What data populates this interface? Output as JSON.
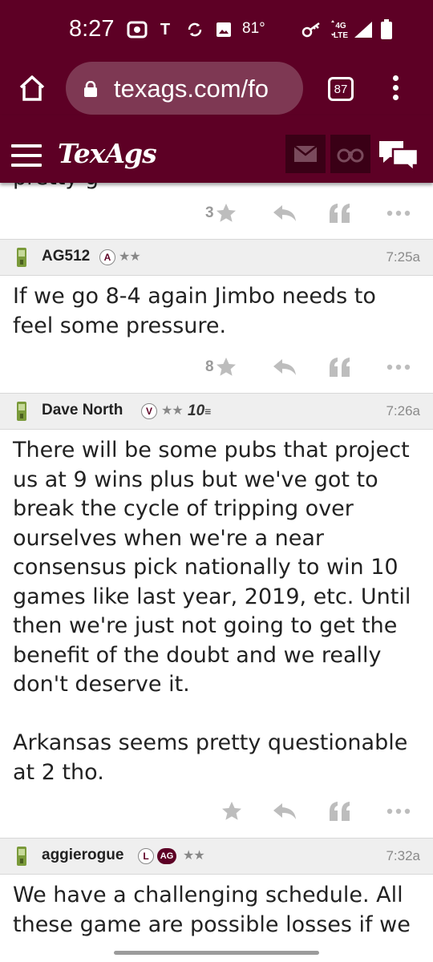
{
  "status_bar": {
    "time": "8:27",
    "carrier_glyph": "T",
    "temperature": "81°",
    "network": "4G LTE"
  },
  "browser": {
    "url": "texags.com/fo",
    "tab_count": "87",
    "icons": [
      "home-icon",
      "lock-icon",
      "tabs-icon",
      "menu-icon"
    ]
  },
  "site_header": {
    "logo": "TexAgs",
    "icons": [
      "hamburger-icon",
      "mail-icon",
      "binoculars-icon",
      "chat-icon"
    ]
  },
  "colors": {
    "brand_maroon": "#5d0025",
    "url_pill": "#7e3853",
    "header_square": "#3a0016",
    "post_header_bg": "#efefef",
    "action_grey": "#bdbdbd",
    "phone_green": "#7a9a3a"
  },
  "previous_post": {
    "clipped_text": "pretty g",
    "star_count": "3"
  },
  "posts": [
    {
      "username": "AG512",
      "badges": [
        "A"
      ],
      "stars": "★★",
      "time": "7:25a",
      "body": "If we go 8-4 again Jimbo needs to feel some pressure.",
      "star_count": "8"
    },
    {
      "username": "Dave North",
      "badges": [
        "V"
      ],
      "stars": "★★",
      "extra_badge": "10",
      "time": "7:26a",
      "body": "There will be some pubs that project us at 9 wins plus but we've got to break the cycle of tripping over ourselves when we're a near consensus pick nationally to win 10 games like last year, 2019, etc. Until then we're just not going to get the benefit of the doubt and we really don't deserve it.\n\nArkansas seems pretty questionable at 2 tho.",
      "star_count": ""
    },
    {
      "username": "aggierogue",
      "badges": [
        "L",
        "AG"
      ],
      "stars": "★★",
      "time": "7:32a",
      "body": "We have a challenging schedule. All these game are possible losses if we"
    }
  ]
}
